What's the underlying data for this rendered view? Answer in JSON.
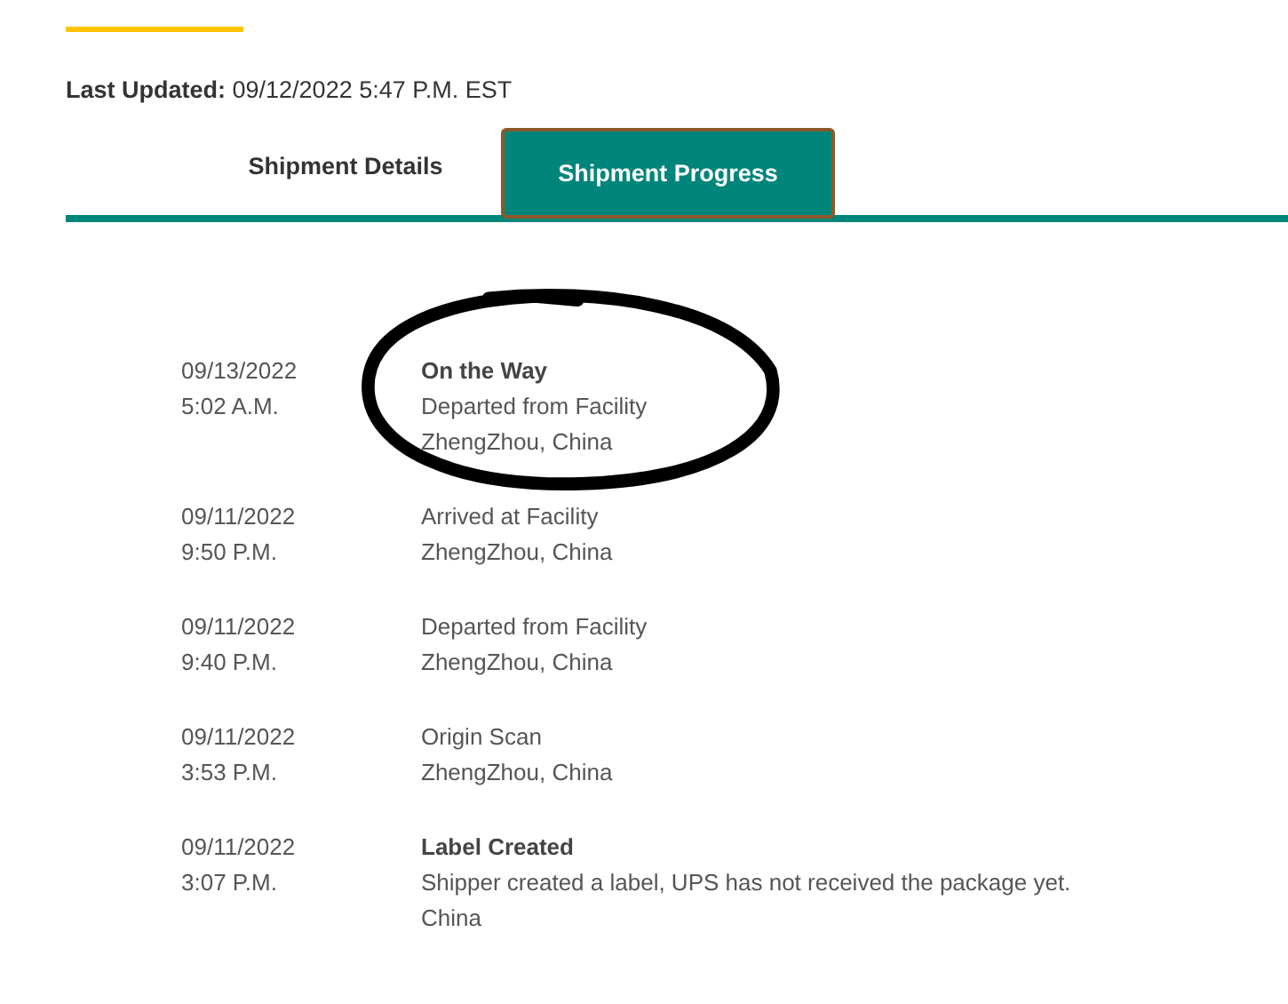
{
  "last_updated": {
    "label": "Last Updated:",
    "value": "09/12/2022 5:47 P.M. EST"
  },
  "tabs": [
    {
      "label": "Shipment Details",
      "selected": false
    },
    {
      "label": "Shipment Progress",
      "selected": true
    }
  ],
  "events": [
    {
      "date": "09/13/2022",
      "time": "5:02 A.M.",
      "status": "On the Way",
      "details": [
        "Departed from Facility",
        "ZhengZhou, China"
      ],
      "circled": true
    },
    {
      "date": "09/11/2022",
      "time": "9:50 P.M.",
      "details": [
        "Arrived at Facility",
        "ZhengZhou, China"
      ],
      "circled": false
    },
    {
      "date": "09/11/2022",
      "time": "9:40 P.M.",
      "details": [
        "Departed from Facility",
        "ZhengZhou, China"
      ],
      "circled": false
    },
    {
      "date": "09/11/2022",
      "time": "3:53 P.M.",
      "details": [
        "Origin Scan",
        "ZhengZhou, China"
      ],
      "circled": false
    },
    {
      "date": "09/11/2022",
      "time": "3:07 P.M.",
      "status": "Label Created",
      "details": [
        "Shipper created a label, UPS has not received the package yet.",
        "China"
      ],
      "circled": false
    }
  ]
}
